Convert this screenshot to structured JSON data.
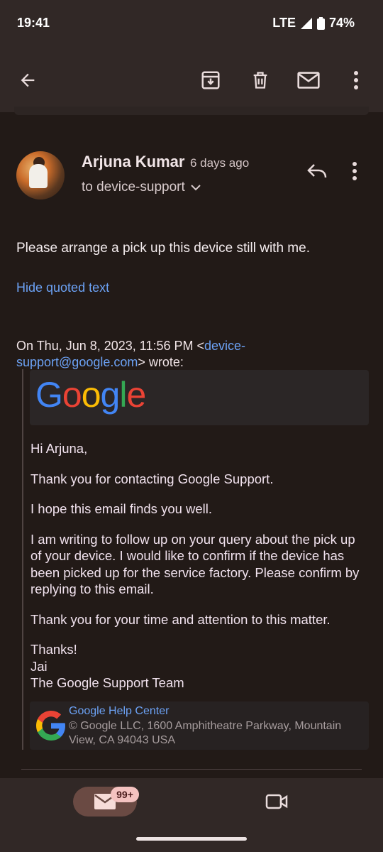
{
  "status_bar": {
    "time": "19:41",
    "network": "LTE",
    "battery": "74%"
  },
  "toolbar": {
    "back_icon": "arrow-back-icon",
    "archive_icon": "archive-icon",
    "delete_icon": "delete-icon",
    "mark_unread_icon": "mail-icon",
    "more_icon": "more-vert-icon"
  },
  "message": {
    "sender": "Arjuna Kumar",
    "sent_ago": "6 days ago",
    "recipient": "to device-support",
    "body": "Please arrange a pick up this device still with me.",
    "hide_quoted": "Hide quoted text"
  },
  "quote": {
    "intro_prefix": "On Thu, Jun 8, 2023, 11:56 PM <",
    "intro_email": "device-support@google.com",
    "intro_suffix": "> wrote:",
    "logo": {
      "g1": "G",
      "o1": "o",
      "o2": "o",
      "g2": "g",
      "l": "l",
      "e": "e"
    },
    "greeting": "Hi Arjuna,",
    "p1": "Thank you for contacting Google Support.",
    "p2": "I hope this email finds you well.",
    "p3": "I am writing to follow up on your query about the pick up of your device. I would like to confirm if the device has been picked up for the service factory. Please confirm by replying to this email.",
    "p4": "Thank you for your time and attention to this matter.",
    "signoff_1": "Thanks!",
    "signoff_2": "Jai",
    "signoff_3": "The Google Support Team",
    "footer_link": "Google Help Center",
    "footer_address": "© Google LLC, 1600 Amphitheatre Parkway, Mountain View, CA 94043 USA"
  },
  "bottom_nav": {
    "mail_badge": "99+"
  },
  "colors": {
    "background": "#221a17",
    "bar": "#312826",
    "link": "#6ca2f5",
    "pill": "#6a4a43"
  }
}
